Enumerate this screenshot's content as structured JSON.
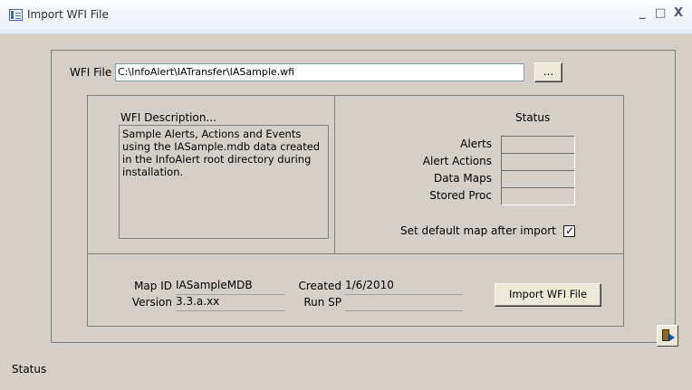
{
  "window": {
    "title": "Import WFI File",
    "minimize_glyph": "_",
    "maximize_glyph": "□",
    "close_glyph": "X"
  },
  "file": {
    "label": "WFI File",
    "value": "C:\\InfoAlert\\IATransfer\\IASample.wfi",
    "browse_label": "..."
  },
  "description": {
    "label": "WFI Description...",
    "text": "Sample Alerts, Actions and Events using the IASample.mdb data created in the InfoAlert root directory during installation."
  },
  "status_panel": {
    "header": "Status",
    "rows": [
      {
        "label": "Alerts"
      },
      {
        "label": "Alert Actions"
      },
      {
        "label": "Data Maps"
      },
      {
        "label": "Stored Proc"
      }
    ],
    "default_map_label": "Set default map after import",
    "default_map_checked": true,
    "check_glyph": "✓"
  },
  "meta": {
    "map_id_label": "Map ID",
    "map_id_value": "IASampleMDB",
    "version_label": "Version",
    "version_value": "3.3.a.xx",
    "created_label": "Created",
    "created_value": "1/6/2010",
    "run_sp_label": "Run SP",
    "run_sp_value": ""
  },
  "import_button_label": "Import WFI File",
  "footer": {
    "status_label": "Status",
    "exit_icon": "exit-door-icon"
  }
}
